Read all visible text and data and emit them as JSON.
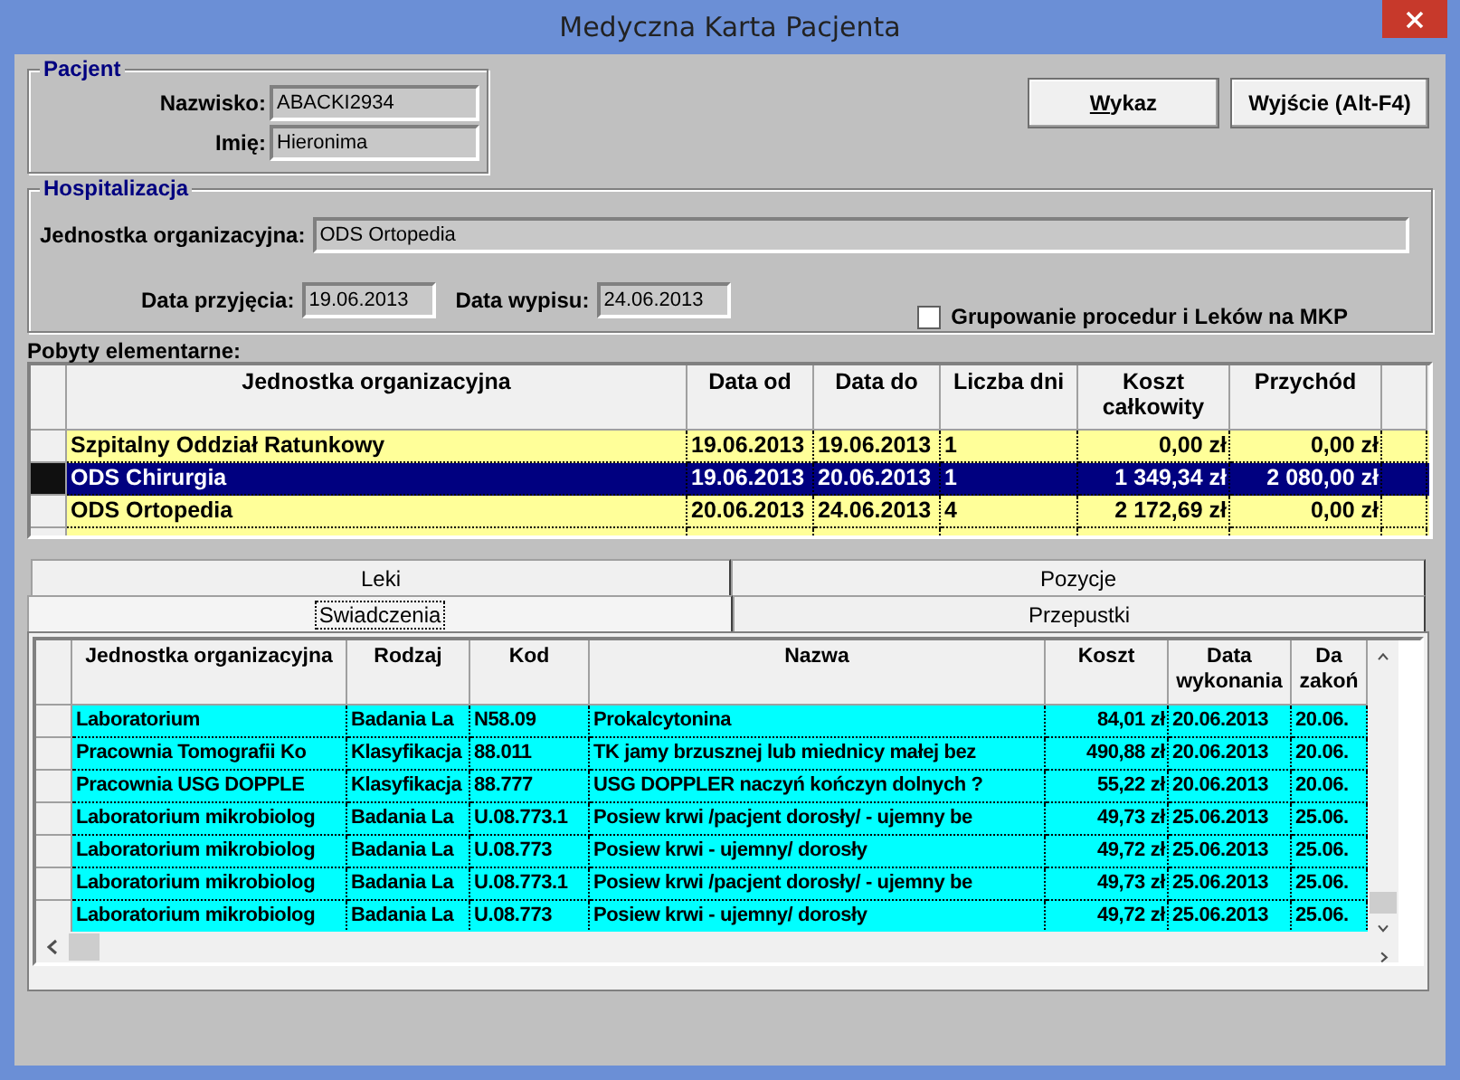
{
  "window": {
    "title": "Medyczna Karta Pacjenta"
  },
  "pacjent": {
    "title": "Pacjent",
    "fields": [
      {
        "label": "Nazwisko:",
        "value": "ABACKI2934"
      },
      {
        "label": "Imię:",
        "value": "Hieronima"
      }
    ]
  },
  "buttons": [
    {
      "label": "Wykaz",
      "underlined_first": true
    },
    {
      "label": "Wyjście (Alt-F4)"
    }
  ],
  "hospitalizacja": {
    "title": "Hospitalizacja",
    "unit": {
      "label": "Jednostka organizacyjna:",
      "value": "ODS Ortopedia"
    },
    "admission": {
      "label": "Data przyjęcia:",
      "value": "19.06.2013"
    },
    "discharge": {
      "label": "Data wypisu:",
      "value": "24.06.2013"
    },
    "grouping": {
      "label": "Grupowanie procedur i Leków na MKP",
      "checked": false
    }
  },
  "stays": {
    "title": "Pobyty elementarne:",
    "columns": [
      "Jednostka organizacyjna",
      "Data od",
      "Data do",
      "Liczba dni",
      "Koszt\ncałkowity",
      "Przychód"
    ],
    "rows": [
      {
        "cells": [
          "Szpitalny Oddział Ratunkowy",
          "19.06.2013",
          "19.06.2013",
          "1",
          "0,00 zł",
          "0,00 zł"
        ],
        "selected": false
      },
      {
        "cells": [
          "ODS Chirurgia",
          "19.06.2013",
          "20.06.2013",
          "1",
          "1 349,34 zł",
          "2 080,00 zł"
        ],
        "selected": true
      },
      {
        "cells": [
          "ODS Ortopedia",
          "20.06.2013",
          "24.06.2013",
          "4",
          "2 172,69 zł",
          "0,00 zł"
        ],
        "selected": false
      }
    ]
  },
  "tab_rows": [
    [
      {
        "label": "Leki",
        "selected": false
      },
      {
        "label": "Pozycje",
        "selected": false
      }
    ],
    [
      {
        "label": "Swiadczenia",
        "selected": true
      },
      {
        "label": "Przepustki",
        "selected": false
      }
    ]
  ],
  "services": {
    "columns": [
      "Jednostka organizacyjna",
      "Rodzaj",
      "Kod",
      "Nazwa",
      "Koszt",
      "Data\nwykonania",
      "Da\nzakoń"
    ],
    "rows": [
      {
        "cells": [
          "Laboratorium",
          "Badania La",
          "N58.09",
          "Prokalcytonina",
          "84,01 zł",
          "20.06.2013",
          "20.06."
        ]
      },
      {
        "cells": [
          "Pracownia Tomografii Ko",
          "Klasyfikacja",
          "88.011",
          "TK jamy brzusznej lub miednicy małej bez",
          "490,88 zł",
          "20.06.2013",
          "20.06."
        ]
      },
      {
        "cells": [
          "Pracownia USG DOPPLE",
          "Klasyfikacja",
          "88.777",
          "USG DOPPLER naczyń kończyn dolnych ?",
          "55,22 zł",
          "20.06.2013",
          "20.06."
        ]
      },
      {
        "cells": [
          "Laboratorium mikrobiolog",
          "Badania La",
          "U.08.773.1",
          "Posiew krwi /pacjent dorosły/ - ujemny be",
          "49,73 zł",
          "25.06.2013",
          "25.06."
        ]
      },
      {
        "cells": [
          "Laboratorium mikrobiolog",
          "Badania La",
          "U.08.773",
          "Posiew krwi - ujemny/ dorosły",
          "49,72 zł",
          "25.06.2013",
          "25.06."
        ]
      },
      {
        "cells": [
          "Laboratorium mikrobiolog",
          "Badania La",
          "U.08.773.1",
          "Posiew krwi /pacjent dorosły/ - ujemny be",
          "49,73 zł",
          "25.06.2013",
          "25.06."
        ]
      },
      {
        "cells": [
          "Laboratorium mikrobiolog",
          "Badania La",
          "U.08.773",
          "Posiew krwi - ujemny/ dorosły",
          "49,72 zł",
          "25.06.2013",
          "25.06."
        ]
      }
    ]
  }
}
